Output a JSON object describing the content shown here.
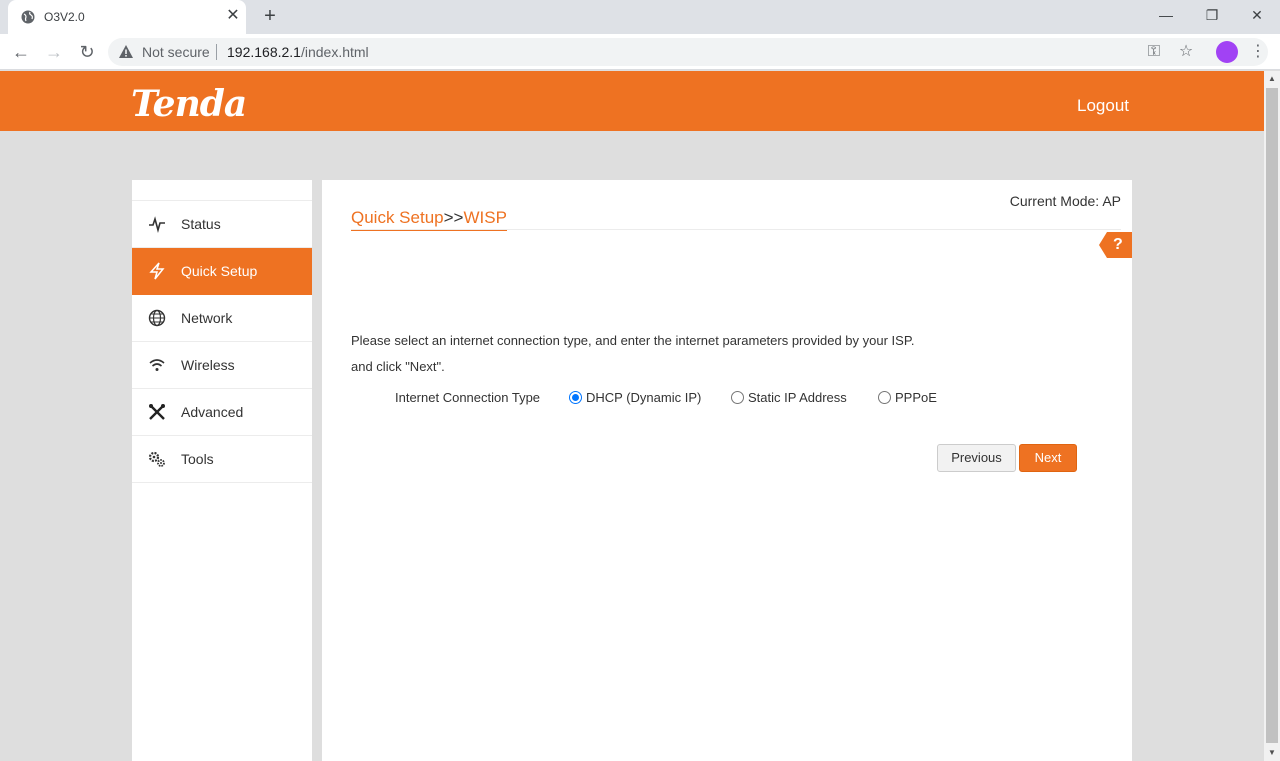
{
  "browser": {
    "tab_title": "O3V2.0",
    "tab_close": "✕",
    "new_tab": "+",
    "minimize": "—",
    "restore": "❐",
    "close": "✕",
    "not_secure": "Not secure",
    "url_host": "192.168.2.1",
    "url_path": "/index.html"
  },
  "header": {
    "logo": "Tenda",
    "logout": "Logout"
  },
  "sidebar": {
    "items": [
      {
        "label": "Status",
        "icon": "pulse-icon"
      },
      {
        "label": "Quick Setup",
        "icon": "lightning-icon"
      },
      {
        "label": "Network",
        "icon": "globe-icon"
      },
      {
        "label": "Wireless",
        "icon": "wifi-icon"
      },
      {
        "label": "Advanced",
        "icon": "tools-cross-icon"
      },
      {
        "label": "Tools",
        "icon": "gears-icon"
      }
    ],
    "active_index": 1
  },
  "content": {
    "current_mode": "Current Mode: AP",
    "breadcrumb_part1": "Quick Setup",
    "breadcrumb_sep": ">>",
    "breadcrumb_part2": "WISP",
    "help": "?",
    "desc_line1": "Please select an internet connection type, and enter the internet parameters provided by your ISP.",
    "desc_line2": "and click \"Next\".",
    "conn_label": "Internet Connection Type",
    "options": [
      {
        "label": "DHCP (Dynamic IP)",
        "checked": true
      },
      {
        "label": "Static IP Address",
        "checked": false
      },
      {
        "label": "PPPoE",
        "checked": false
      }
    ],
    "btn_previous": "Previous",
    "btn_next": "Next"
  },
  "colors": {
    "accent": "#ee7222",
    "radio": "#0075ff"
  }
}
